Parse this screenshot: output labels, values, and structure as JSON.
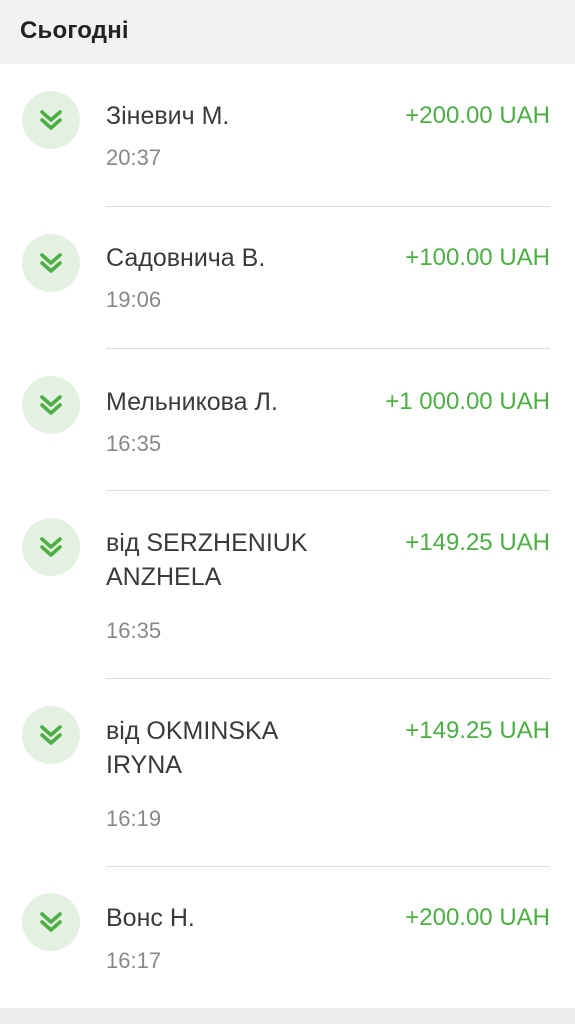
{
  "section": {
    "title": "Сьогодні"
  },
  "colors": {
    "amount_green": "#4caf43",
    "icon_bg": "#e4f1e2",
    "icon_fg": "#4caf43"
  },
  "transactions": [
    {
      "name": "Зіневич М.",
      "time": "20:37",
      "amount": "+200.00 UAH",
      "icon": "double-chevron-down-icon"
    },
    {
      "name": "Садовнича В.",
      "time": "19:06",
      "amount": "+100.00 UAH",
      "icon": "double-chevron-down-icon"
    },
    {
      "name": "Мельникова Л.",
      "time": "16:35",
      "amount": "+1 000.00 UAH",
      "icon": "double-chevron-down-icon"
    },
    {
      "name": "від SERZHENIUK ANZHELA",
      "time": "16:35",
      "amount": "+149.25 UAH",
      "icon": "double-chevron-down-icon"
    },
    {
      "name": "від OKMINSKA IRYNA",
      "time": "16:19",
      "amount": "+149.25 UAH",
      "icon": "double-chevron-down-icon"
    },
    {
      "name": "Вонс Н.",
      "time": "16:17",
      "amount": "+200.00 UAH",
      "icon": "double-chevron-down-icon"
    }
  ]
}
